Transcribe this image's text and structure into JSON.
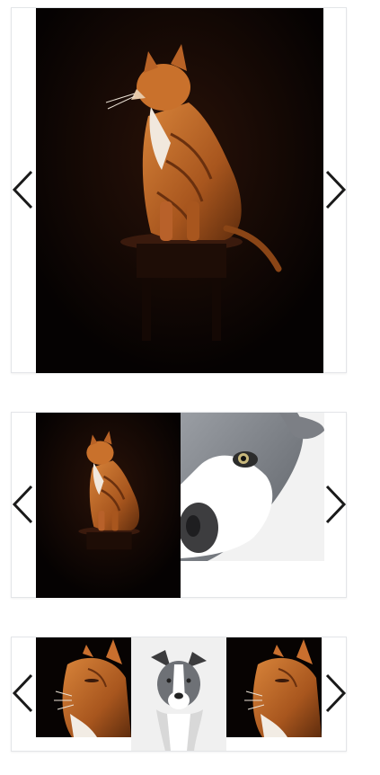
{
  "colors": {
    "arrow": "#1a1a1a",
    "frame_border": "#e3e5e8",
    "cat_background": "#0a0504",
    "dog_background": "#f2f2f2"
  },
  "icons": {
    "previous": "chevron-left-icon",
    "next": "chevron-right-icon"
  },
  "carousels": [
    {
      "slides_visible": 1,
      "slides": [
        {
          "image": "orange-tabby-cat-sitting-on-stool"
        }
      ]
    },
    {
      "slides_visible": 2,
      "slides": [
        {
          "image": "orange-tabby-cat-sitting-on-stool"
        },
        {
          "image": "grey-white-dog-face-closeup"
        }
      ]
    },
    {
      "slides_visible": 3,
      "slides": [
        {
          "image": "orange-tabby-cat-closeup"
        },
        {
          "image": "grey-white-dog-portrait"
        },
        {
          "image": "orange-tabby-cat-closeup"
        }
      ]
    }
  ]
}
